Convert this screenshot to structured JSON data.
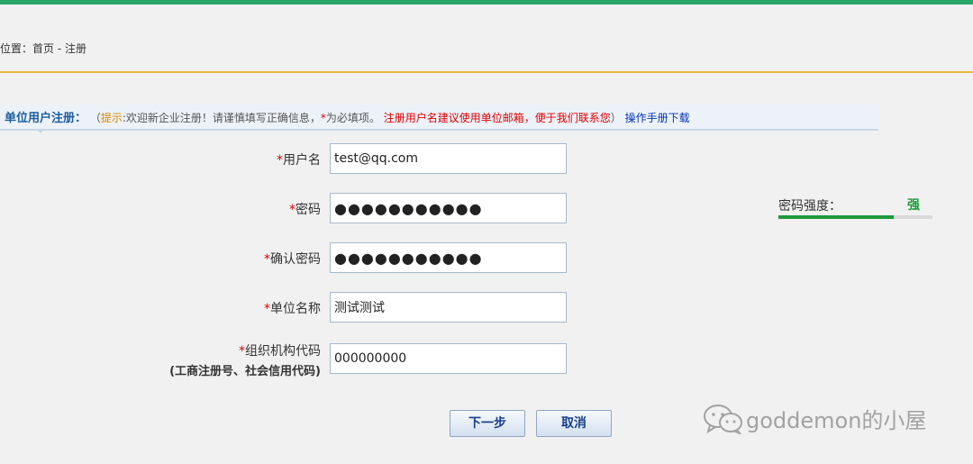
{
  "breadcrumb": {
    "prefix": "位置：",
    "home": "首页",
    "separator": " - ",
    "current": "注册"
  },
  "section": {
    "title": "单位用户注册：",
    "paren_open": "（",
    "hint_word": "提示",
    "hint_text": ":欢迎新企业注册！请谨慎填写正确信息，",
    "star": "*",
    "required_text": "为必填项。",
    "red_note": "注册用户名建议使用单位邮箱，便于我们联系您",
    "paren_close": "）",
    "manual_link": "操作手册下载"
  },
  "form": {
    "required_mark": "*",
    "username": {
      "label": "用户名",
      "value": "test@qq.com"
    },
    "password": {
      "label": "密码",
      "value": "●●●●●●●●●●●"
    },
    "confirm_password": {
      "label": "确认密码",
      "value": "●●●●●●●●●●●"
    },
    "org_name": {
      "label": "单位名称",
      "value": "测试测试"
    },
    "org_code": {
      "label": "组织机构代码",
      "sublabel": "(工商注册号、社会信用代码)",
      "value": "000000000"
    }
  },
  "strength": {
    "label": "密码强度：",
    "value": "强",
    "level": 0.75,
    "color": "#1e9a3c"
  },
  "buttons": {
    "next": "下一步",
    "cancel": "取消"
  },
  "watermark": {
    "text": "goddemon的小屋"
  },
  "colors": {
    "top_bar": "#2aa56a",
    "divider": "#e8b93a",
    "title_blue": "#1c5d9e",
    "required_red": "#e10000"
  }
}
